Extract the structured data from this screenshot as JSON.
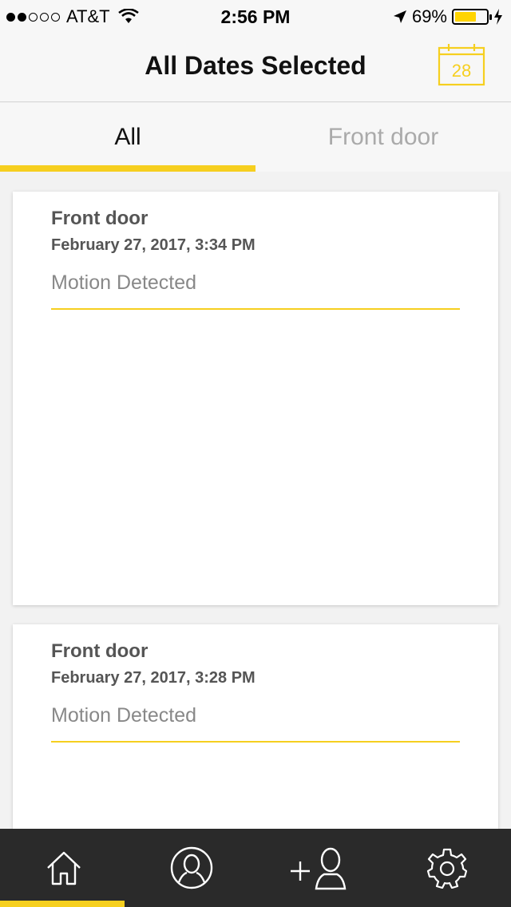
{
  "status_bar": {
    "carrier": "AT&T",
    "time": "2:56 PM",
    "battery": "69%",
    "signal_bars_filled": 2,
    "signal_bars_total": 5,
    "battery_level": 0.69
  },
  "header": {
    "title": "All Dates Selected",
    "calendar_day": "28",
    "accent_color": "#f6cf1f"
  },
  "tabs": {
    "all_label": "All",
    "front_label": "Front door",
    "active": "All"
  },
  "events": [
    {
      "device": "Front door",
      "datetime": "February 27, 2017, 3:34 PM",
      "event": "Motion Detected"
    },
    {
      "device": "Front door",
      "datetime": "February 27, 2017, 3:28 PM",
      "event": "Motion Detected"
    }
  ],
  "nav": {
    "items": [
      "home-icon",
      "profile-icon",
      "add-person-icon",
      "settings-icon"
    ],
    "active": "home-icon"
  }
}
